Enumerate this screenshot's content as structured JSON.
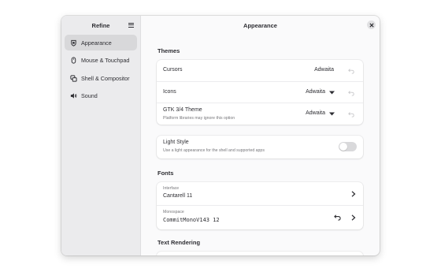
{
  "sidebar": {
    "title": "Refine",
    "menu_icon": "hamburger-menu-icon",
    "items": [
      {
        "label": "Appearance",
        "icon": "appearance-icon",
        "active": true
      },
      {
        "label": "Mouse & Touchpad",
        "icon": "mouse-icon",
        "active": false
      },
      {
        "label": "Shell & Compositor",
        "icon": "windows-icon",
        "active": false
      },
      {
        "label": "Sound",
        "icon": "speaker-icon",
        "active": false
      }
    ]
  },
  "main": {
    "title": "Appearance",
    "close_icon": "close-icon"
  },
  "themes": {
    "section_title": "Themes",
    "cursors": {
      "label": "Cursors",
      "value": "Adwaita"
    },
    "icons": {
      "label": "Icons",
      "value": "Adwaita"
    },
    "gtk": {
      "label": "GTK 3/4 Theme",
      "subtitle": "Platform libraries may ignore this option",
      "value": "Adwaita"
    }
  },
  "light_style": {
    "label": "Light Style",
    "subtitle": "Use a light appearance for the shell and supported apps",
    "enabled": false
  },
  "fonts": {
    "section_title": "Fonts",
    "interface": {
      "label": "Interface",
      "value": "Cantarell 11"
    },
    "monospace": {
      "label": "Monospace",
      "value": "CommitMonoV143 12"
    }
  },
  "text_rendering": {
    "section_title": "Text Rendering"
  },
  "colors": {
    "sidebar_bg": "#ebebed",
    "active_item_bg": "#d8d8da",
    "switch_off": "#d9d9db"
  }
}
